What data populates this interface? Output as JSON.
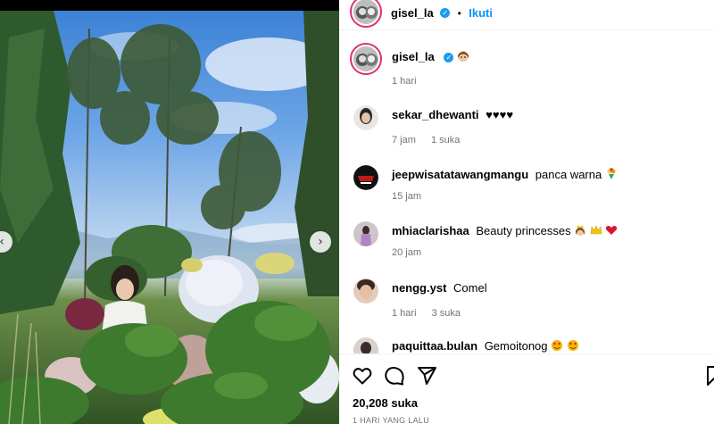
{
  "post": {
    "author": "gisel_la",
    "follow_label": "Ikuti",
    "separator": "•",
    "caption_age": "1 hari",
    "likes": "20,208 suka",
    "posted_ago": "1 HARI YANG LALU"
  },
  "comments": [
    {
      "username": "sekar_dhewanti",
      "text": "♥♥♥♥",
      "age": "7 jam",
      "likes": "1 suka"
    },
    {
      "username": "jeepwisatatawangmangu",
      "text": "panca warna",
      "age": "15 jam",
      "likes": ""
    },
    {
      "username": "mhiaclarishaa",
      "text": "Beauty princesses",
      "age": "20 jam",
      "likes": ""
    },
    {
      "username": "nengg.yst",
      "text": "Comel",
      "age": "1 hari",
      "likes": "3 suka"
    },
    {
      "username": "paquittaa.bulan",
      "text": "Gemoitonog",
      "age": "",
      "likes": ""
    }
  ],
  "icons": {
    "like": "heart-icon",
    "comment": "comment-icon",
    "share": "share-icon",
    "save": "bookmark-icon"
  },
  "colors": {
    "follow": "#0095f6",
    "verified": "#1d9bf0",
    "muted": "#737373"
  }
}
